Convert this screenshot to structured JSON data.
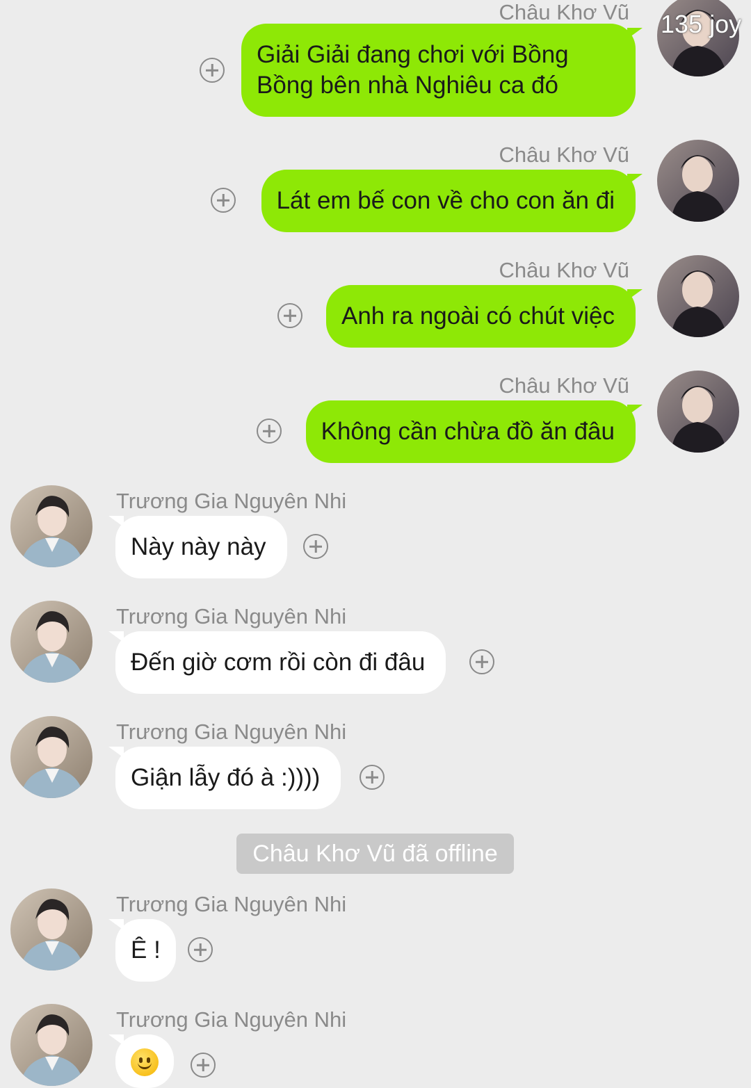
{
  "watermark": "135 joy",
  "messages_right": [
    {
      "sender": "Châu Khơ Vũ",
      "text": "Giải Giải đang chơi với Bồng Bồng bên nhà Nghiêu ca đó"
    },
    {
      "sender": "Châu Khơ Vũ",
      "text": "Lát em bế con về cho con ăn đi"
    },
    {
      "sender": "Châu Khơ Vũ",
      "text": "Anh ra ngoài có chút việc"
    },
    {
      "sender": "Châu Khơ Vũ",
      "text": "Không cần chừa đồ ăn đâu"
    }
  ],
  "messages_left": [
    {
      "sender": "Trương Gia Nguyên Nhi",
      "text": "Này này này"
    },
    {
      "sender": "Trương Gia Nguyên Nhi",
      "text": "Đến giờ cơm rồi còn đi đâu"
    },
    {
      "sender": "Trương Gia Nguyên Nhi",
      "text": "Giận lẫy đó à :))))"
    },
    {
      "sender": "Trương Gia Nguyên Nhi",
      "text": "Ê !"
    },
    {
      "sender": "Trương Gia Nguyên Nhi",
      "emoji": "smiling-face-emoji"
    }
  ],
  "system_notice": "Châu Khơ Vũ đã offline",
  "colors": {
    "background": "#ececec",
    "sent_bubble": "#8ee806",
    "received_bubble": "#ffffff",
    "notice_bg": "#c9c9c9"
  }
}
